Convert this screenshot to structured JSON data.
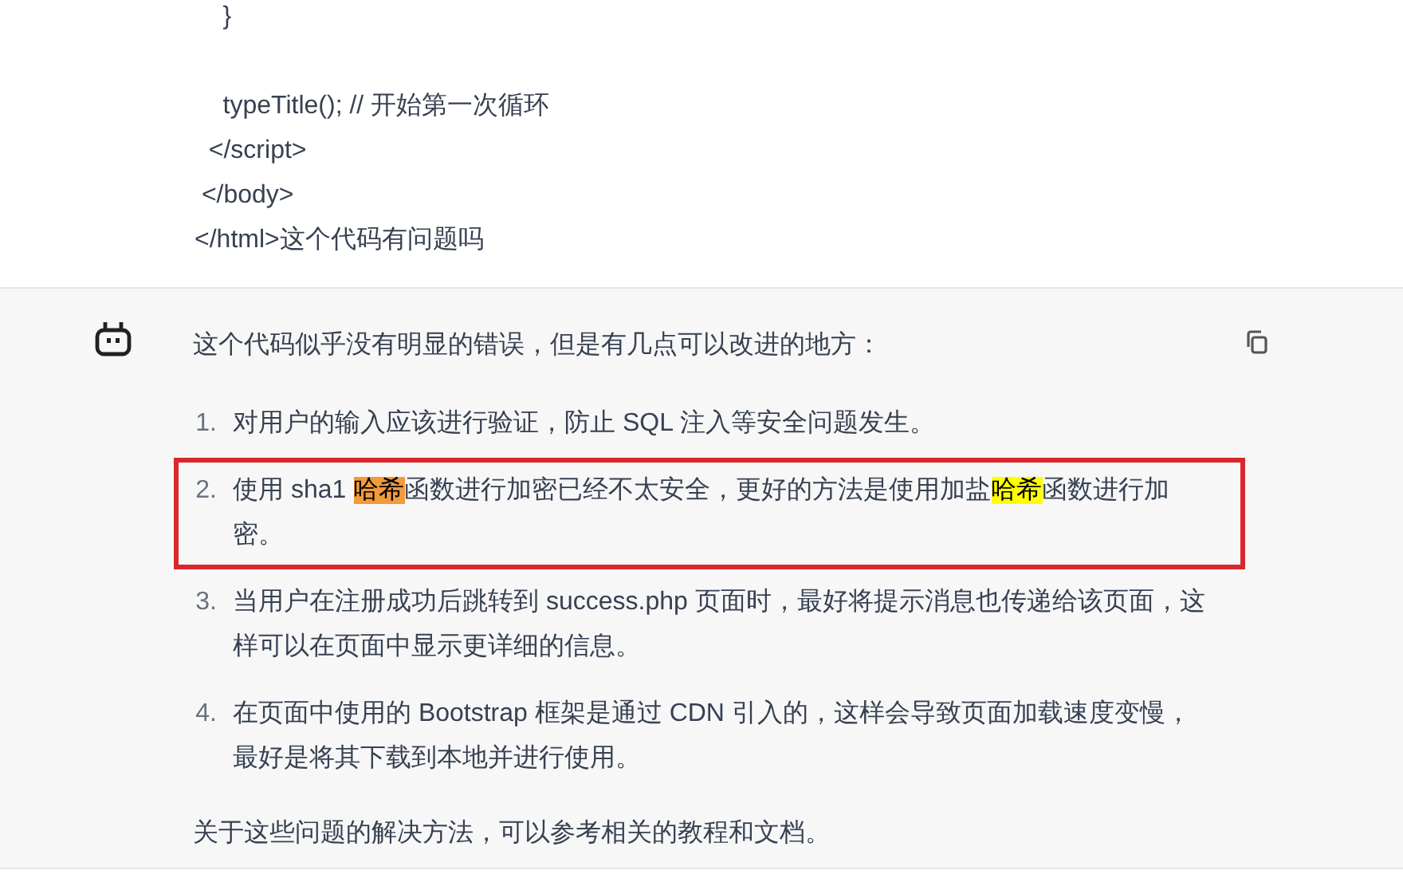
{
  "user_message": {
    "lines": [
      [
        "    }"
      ],
      [
        "    typeTitle(); // 开始第一次循环",
        "  </script>",
        " </body>",
        "</html>这个代码有问题吗"
      ]
    ]
  },
  "reply": {
    "intro": "这个代码似乎没有明显的错误，但是有几点可以改进的地方：",
    "items": [
      {
        "number": "1.",
        "boxed": false,
        "segments": [
          {
            "kind": "plain",
            "text": "对用户的输入应该进行验证，防止 SQL 注入等安全问题发生。"
          }
        ]
      },
      {
        "number": "2.",
        "boxed": true,
        "segments": [
          {
            "kind": "plain",
            "text": "使用 sha1 "
          },
          {
            "kind": "match",
            "text": "哈希",
            "selected": true
          },
          {
            "kind": "plain",
            "text": "函数进行加密已经不太安全，更好的方法是使用加盐"
          },
          {
            "kind": "match",
            "text": "哈希",
            "selected": false
          },
          {
            "kind": "plain",
            "text": "函数进行加密。"
          }
        ]
      },
      {
        "number": "3.",
        "boxed": false,
        "segments": [
          {
            "kind": "plain",
            "text": "当用户在注册成功后跳转到 success.php 页面时，最好将提示消息也传递给该页面，这样可以在页面中显示更详细的信息。"
          }
        ]
      },
      {
        "number": "4.",
        "boxed": false,
        "segments": [
          {
            "kind": "plain",
            "text": "在页面中使用的 Bootstrap 框架是通过 CDN 引入的，这样会导致页面加载速度变慢，最好是将其下载到本地并进行使用。"
          }
        ]
      }
    ],
    "outro": "关于这些问题的解决方法，可以参考相关的教程和文档。"
  }
}
